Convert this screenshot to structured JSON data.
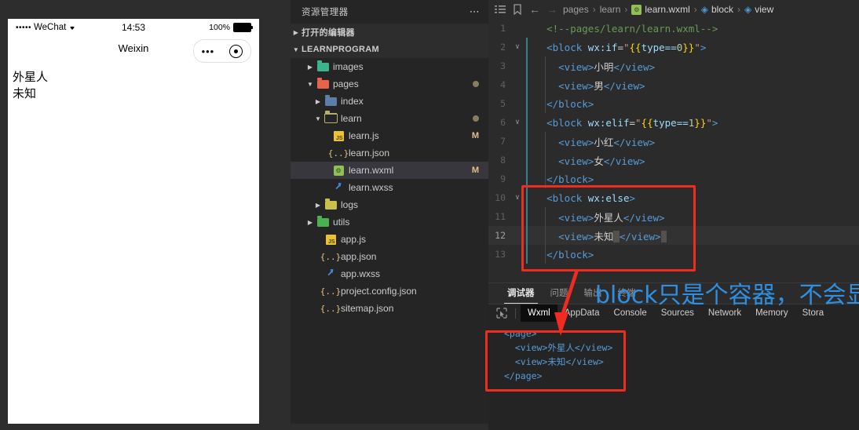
{
  "simulator": {
    "status_bar": {
      "dots": "•••••",
      "carrier": "WeChat",
      "wifi_icon": "wifi-icon",
      "time": "14:53",
      "battery_percent": "100%",
      "battery_icon": "battery-full-icon"
    },
    "nav": {
      "title": "Weixin",
      "capsule_menu_icon": "more-dots-icon",
      "capsule_close_icon": "target-circle-icon"
    },
    "page_lines": [
      "外星人",
      "未知"
    ]
  },
  "explorer": {
    "header": {
      "title": "资源管理器",
      "more_icon": "ellipsis-icon"
    },
    "sections": [
      {
        "label": "打开的编辑器",
        "expanded": false
      },
      {
        "label": "LEARNPROGRAM",
        "expanded": true
      }
    ],
    "tree": [
      {
        "label": "images",
        "indent": 1,
        "type": "folder",
        "icon": "folder-images-icon",
        "twisty": "▸",
        "badge": ""
      },
      {
        "label": "pages",
        "indent": 1,
        "type": "folder",
        "icon": "folder-pages-icon",
        "twisty": "▾",
        "badge": "dot"
      },
      {
        "label": "index",
        "indent": 2,
        "type": "folder",
        "icon": "folder-index-icon",
        "twisty": "▸",
        "badge": ""
      },
      {
        "label": "learn",
        "indent": 2,
        "type": "folder",
        "icon": "folder-open-icon",
        "twisty": "▾",
        "badge": "dot"
      },
      {
        "label": "learn.js",
        "indent": 3,
        "type": "js",
        "icon": "file-js-icon",
        "twisty": "",
        "badge": "M"
      },
      {
        "label": "learn.json",
        "indent": 3,
        "type": "json",
        "icon": "file-json-icon",
        "twisty": "",
        "badge": ""
      },
      {
        "label": "learn.wxml",
        "indent": 3,
        "type": "wxml",
        "icon": "file-wxml-icon",
        "twisty": "",
        "badge": "M",
        "selected": true
      },
      {
        "label": "learn.wxss",
        "indent": 3,
        "type": "wxss",
        "icon": "file-wxss-icon",
        "twisty": "",
        "badge": ""
      },
      {
        "label": "logs",
        "indent": 2,
        "type": "folder",
        "icon": "folder-logs-icon",
        "twisty": "▸",
        "badge": ""
      },
      {
        "label": "utils",
        "indent": 1,
        "type": "folder",
        "icon": "folder-utils-icon",
        "twisty": "▸",
        "badge": ""
      },
      {
        "label": "app.js",
        "indent": 2,
        "type": "js",
        "icon": "file-js-icon",
        "twisty": "",
        "badge": ""
      },
      {
        "label": "app.json",
        "indent": 2,
        "type": "json",
        "icon": "file-json-icon",
        "twisty": "",
        "badge": ""
      },
      {
        "label": "app.wxss",
        "indent": 2,
        "type": "wxss",
        "icon": "file-wxss-icon",
        "twisty": "",
        "badge": ""
      },
      {
        "label": "project.config.json",
        "indent": 2,
        "type": "json",
        "icon": "file-json-icon",
        "twisty": "",
        "badge": ""
      },
      {
        "label": "sitemap.json",
        "indent": 2,
        "type": "json",
        "icon": "file-json-icon",
        "twisty": "",
        "badge": ""
      }
    ]
  },
  "editor": {
    "toolbar": {
      "list_icon": "list-icon",
      "bookmark_icon": "bookmark-icon",
      "back_icon": "arrow-left-icon",
      "forward_icon": "arrow-right-icon"
    },
    "breadcrumb": [
      "pages",
      "learn",
      "learn.wxml",
      "block",
      "view"
    ],
    "lines": [
      {
        "n": "1",
        "fold": "",
        "text": "comment"
      },
      {
        "n": "2",
        "fold": "∨",
        "text": "block-if"
      },
      {
        "n": "3",
        "fold": "",
        "text": "view-xiaoming"
      },
      {
        "n": "4",
        "fold": "",
        "text": "view-nan"
      },
      {
        "n": "5",
        "fold": "",
        "text": "block-close"
      },
      {
        "n": "6",
        "fold": "∨",
        "text": "block-elif"
      },
      {
        "n": "7",
        "fold": "",
        "text": "view-xiaohong"
      },
      {
        "n": "8",
        "fold": "",
        "text": "view-nv"
      },
      {
        "n": "9",
        "fold": "",
        "text": "block-close"
      },
      {
        "n": "10",
        "fold": "∨",
        "text": "block-else"
      },
      {
        "n": "11",
        "fold": "",
        "text": "view-waixingren"
      },
      {
        "n": "12",
        "fold": "",
        "text": "view-weizhi",
        "current": true
      },
      {
        "n": "13",
        "fold": "",
        "text": "block-close"
      }
    ],
    "source_text": {
      "comment": "<!--pages/learn/learn.wxml-->",
      "block_if": "<block wx:if=\"{{type==0}}\">",
      "view_xiaoming": "<view>小明</view>",
      "view_nan": "<view>男</view>",
      "block_close": "</block>",
      "block_elif": "<block wx:elif=\"{{type==1}}\">",
      "view_xiaohong": "<view>小红</view>",
      "view_nv": "<view>女</view>",
      "block_else": "<block wx:else>",
      "view_waixingren": "<view>外星人</view>",
      "view_weizhi": "<view>未知</view>"
    }
  },
  "devtools": {
    "panel_tabs": [
      {
        "label": "调试器",
        "active": true
      },
      {
        "label": "问题",
        "active": false
      },
      {
        "label": "输出",
        "active": false
      },
      {
        "label": "终端",
        "active": false
      }
    ],
    "toolbar": {
      "inspect_icon": "inspect-element-icon"
    },
    "tabs": [
      {
        "label": "Wxml",
        "active": true
      },
      {
        "label": "AppData",
        "active": false
      },
      {
        "label": "Console",
        "active": false
      },
      {
        "label": "Sources",
        "active": false
      },
      {
        "label": "Network",
        "active": false
      },
      {
        "label": "Memory",
        "active": false
      },
      {
        "label": "Stora",
        "active": false
      }
    ],
    "wxml_tree": [
      "<page>",
      "  <view>外星人</view>",
      "  <view>未知</view>",
      "</page>"
    ]
  },
  "annotations": {
    "note_text": "block只是个容器，不会显",
    "note_color": "#2f8fe0",
    "box_color": "#f02c20",
    "arrow_icon": "down-arrow-annotation"
  }
}
